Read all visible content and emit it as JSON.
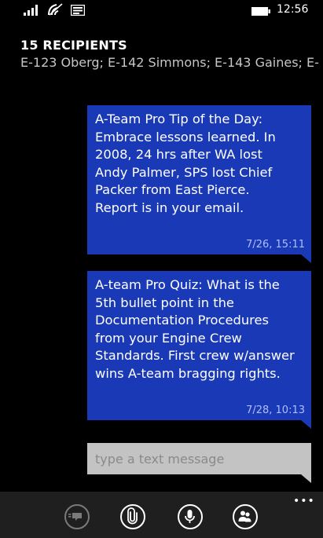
{
  "status_bar": {
    "time": "12:56",
    "icons": [
      "signal-icon",
      "wifi-icon",
      "message-icon",
      "battery-icon"
    ]
  },
  "header": {
    "recipients_count": "15 RECIPIENTS",
    "recipients_list": "E-123 Oberg; E-142 Simmons; E-143 Gaines; E-"
  },
  "messages": [
    {
      "text": "A-Team Pro Tip of the Day:\nEmbrace lessons learned. In\n2008, 24 hrs after WA lost\nAndy Palmer, SPS lost Chief\nPacker from East Pierce.\nReport is in your email.",
      "timestamp": "7/26, 15:11"
    },
    {
      "text": "A-team Pro Quiz: What is the\n5th bullet point in the\nDocumentation Procedures\nfrom your Engine Crew\nStandards. First crew w/answer\nwins A-team bragging rights.",
      "timestamp": "7/28, 10:13"
    }
  ],
  "compose": {
    "placeholder": "type a text message",
    "value": ""
  },
  "app_bar": {
    "buttons": [
      "send-icon",
      "attach-icon",
      "voice-icon",
      "recipients-icon"
    ],
    "more_label": "•••"
  },
  "colors": {
    "background": "#000000",
    "bubble": "#1a39b6",
    "compose": "#c3c3c3",
    "app_bar": "#1f1f1f"
  }
}
